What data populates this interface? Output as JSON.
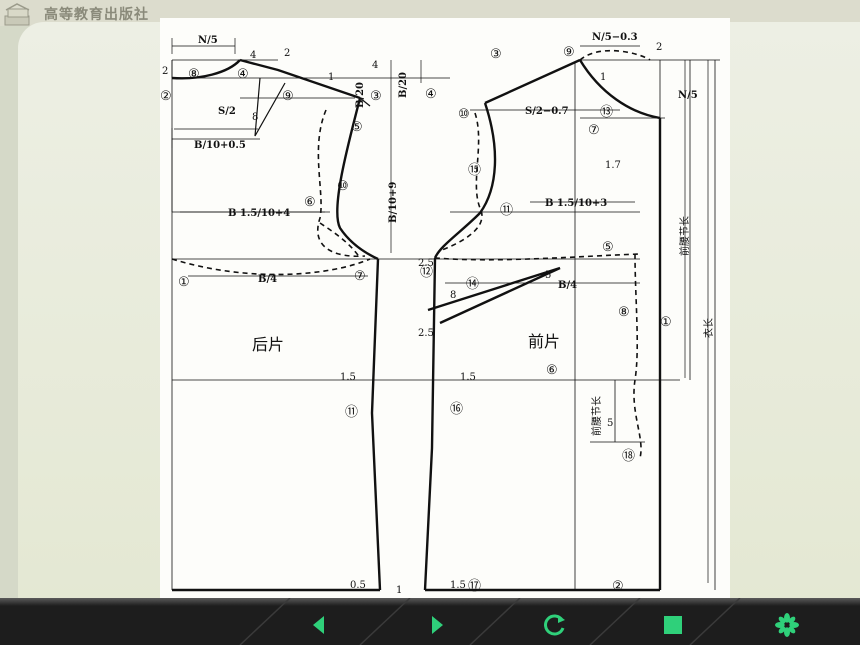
{
  "header": {
    "publisher": "高等教育出版社"
  },
  "diagram": {
    "panel_back": "后片",
    "panel_front": "前片",
    "formulas": {
      "n5": "N/5",
      "n5_minus": "N/5−0.3",
      "s2": "S/2",
      "s2_minus": "S/2−0.7",
      "b10_05": "B/10+0.5",
      "b15_4": "B 1.5/10+4",
      "b15_3": "B 1.5/10+3",
      "b4_back": "B/4",
      "b4_front": "B/4",
      "b20_a": "B/20",
      "b20_b": "B/20",
      "b10_9": "B/10+9",
      "n5_side": "N/5"
    },
    "numbers": [
      "2",
      "4",
      "2",
      "1",
      "4",
      "2",
      "1.7",
      "1",
      "8",
      "2.5",
      "8",
      "2.5",
      "5",
      "1.5",
      "1.5",
      "0.5",
      "1",
      "1.5",
      "5"
    ],
    "circled": [
      "①",
      "②",
      "③",
      "④",
      "⑤",
      "⑥",
      "⑦",
      "⑧",
      "⑨",
      "⑩",
      "⑪",
      "⑫",
      "⑬",
      "⑭",
      "⑮",
      "⑯",
      "⑰",
      "⑱"
    ],
    "vertical_labels": {
      "waist_front_a": "前腰节长",
      "waist_front_b": "前腰节长",
      "length": "衣长"
    },
    "colors": {
      "line": "#111111",
      "paper": "#fdfdfa"
    }
  },
  "toolbar": {
    "buttons": [
      "previous",
      "next",
      "replay",
      "stop",
      "menu"
    ],
    "accent": "#2fd07a"
  }
}
